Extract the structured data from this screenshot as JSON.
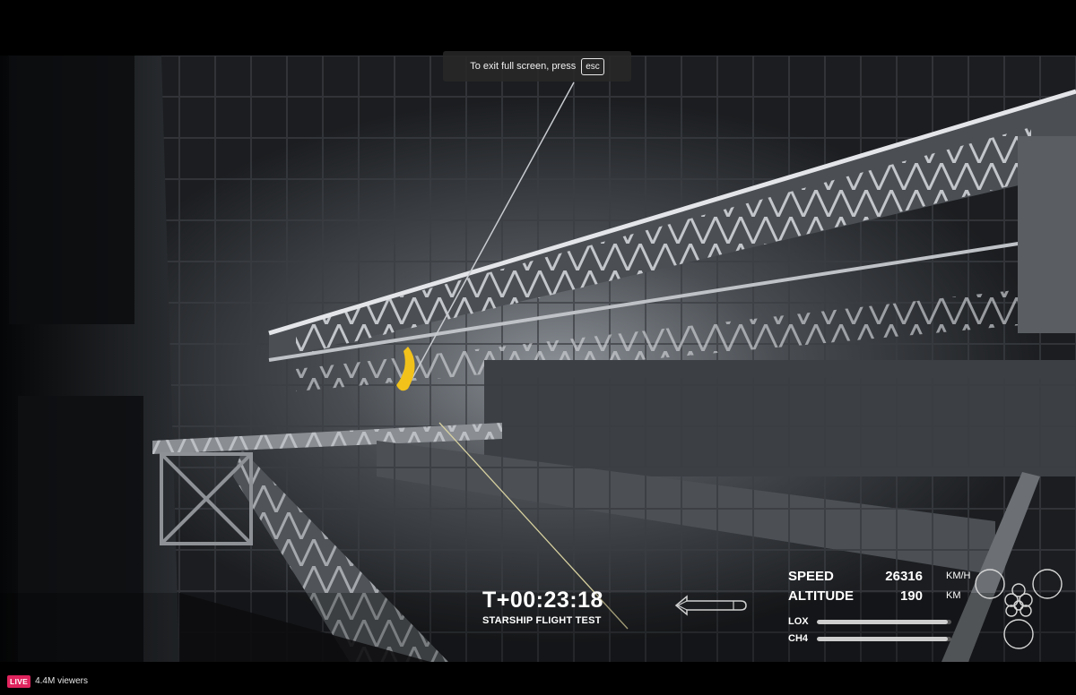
{
  "fullscreen_notice": {
    "text": "To exit full screen, press",
    "key_label": "esc"
  },
  "hud": {
    "timer": "T+00:23:18",
    "mission": "STARSHIP FLIGHT TEST",
    "speed": {
      "label": "SPEED",
      "value": "26316",
      "unit": "KM/H"
    },
    "altitude": {
      "label": "ALTITUDE",
      "value": "190",
      "unit": "KM"
    },
    "propellant": [
      {
        "label": "LOX",
        "level": 0.97
      },
      {
        "label": "CH4",
        "level": 0.97
      }
    ]
  },
  "stream": {
    "live_label": "LIVE",
    "viewers": "4.4M viewers"
  },
  "colors": {
    "live_badge": "#e0245e",
    "hud_text": "#ffffff",
    "banana": "#f2c21b"
  }
}
